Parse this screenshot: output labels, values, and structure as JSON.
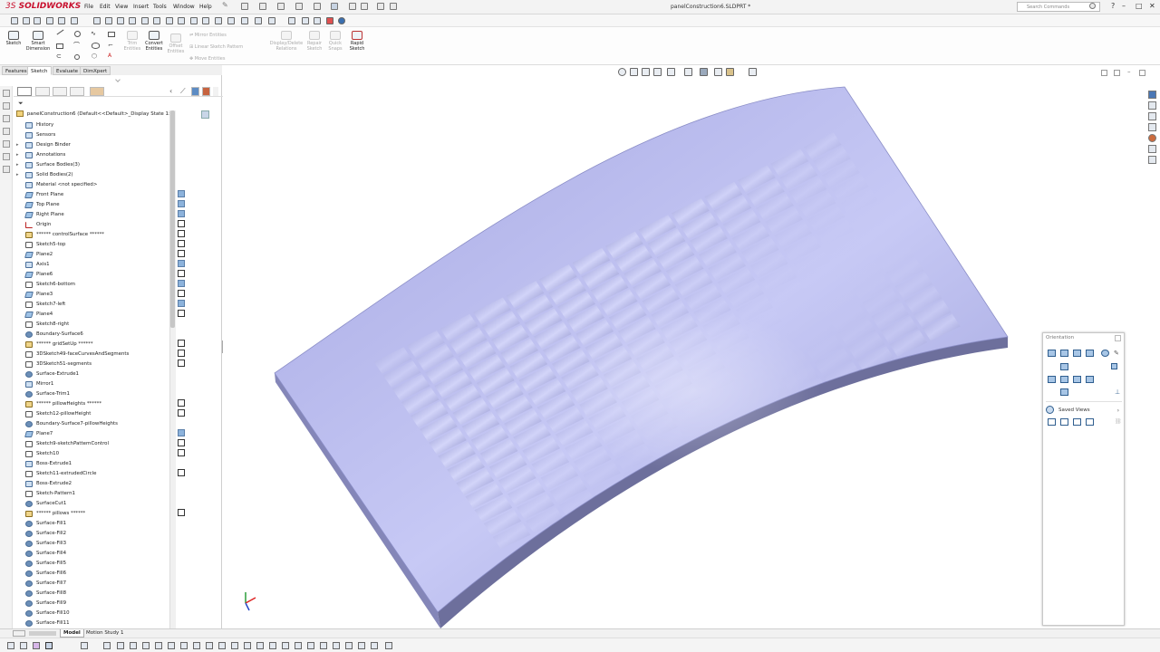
{
  "app": {
    "brand": "SOLIDWORKS",
    "brand_prefix": "3S",
    "document_title": "panelConstruction6.SLDPRT *",
    "search_placeholder": "Search Commands",
    "menus": [
      "File",
      "Edit",
      "View",
      "Insert",
      "Tools",
      "Window",
      "Help"
    ],
    "window_controls": [
      "–",
      "□",
      "✕"
    ]
  },
  "command_manager": {
    "sketch": "Sketch",
    "smart_dimension": "Smart Dimension",
    "trim_entities": "Trim Entities",
    "convert_entities": "Convert Entities",
    "offset_entities": "Offset Entities",
    "mirror_entities": "Mirror Entities",
    "linear_sketch_pattern": "Linear Sketch Pattern",
    "move_entities": "Move Entities",
    "display_delete_relations": "Display/Delete Relations",
    "repair_sketch": "Repair Sketch",
    "quick_snaps": "Quick Snaps",
    "rapid_sketch": "Rapid Sketch"
  },
  "tabs": [
    "Features",
    "Sketch",
    "Evaluate",
    "DimXpert"
  ],
  "active_tab": "Sketch",
  "feature_tree": {
    "root": "panelConstruction6  (Default<<Default>_Display State 1>)",
    "items": [
      {
        "label": "History",
        "icon": "history-icon",
        "expandable": false
      },
      {
        "label": "Sensors",
        "icon": "sensors-icon",
        "expandable": false
      },
      {
        "label": "Design Binder",
        "icon": "design-binder-icon",
        "expandable": true
      },
      {
        "label": "Annotations",
        "icon": "annotations-icon",
        "expandable": true
      },
      {
        "label": "Surface Bodies(3)",
        "icon": "surface-bodies-icon",
        "expandable": true
      },
      {
        "label": "Solid Bodies(2)",
        "icon": "solid-bodies-icon",
        "expandable": true
      },
      {
        "label": "Material <not specified>",
        "icon": "material-icon",
        "expandable": false
      },
      {
        "label": "Front Plane",
        "icon": "plane-icon",
        "expandable": false
      },
      {
        "label": "Top Plane",
        "icon": "plane-icon",
        "expandable": false
      },
      {
        "label": "Right Plane",
        "icon": "plane-icon",
        "expandable": false
      },
      {
        "label": "Origin",
        "icon": "origin-icon",
        "expandable": false
      },
      {
        "label": "****** controlSurface ******",
        "icon": "folder-icon",
        "expandable": false
      },
      {
        "label": "Sketch5-top",
        "icon": "sketch-icon",
        "expandable": false
      },
      {
        "label": "Plane2",
        "icon": "plane-icon",
        "expandable": false
      },
      {
        "label": "Axis1",
        "icon": "axis-icon",
        "expandable": false
      },
      {
        "label": "Plane6",
        "icon": "plane-icon",
        "expandable": false
      },
      {
        "label": "Sketch6-bottom",
        "icon": "sketch-icon",
        "expandable": false
      },
      {
        "label": "Plane3",
        "icon": "plane-icon",
        "expandable": false
      },
      {
        "label": "Sketch7-left",
        "icon": "sketch-icon",
        "expandable": false
      },
      {
        "label": "Plane4",
        "icon": "plane-icon",
        "expandable": false
      },
      {
        "label": "Sketch8-right",
        "icon": "sketch-icon",
        "expandable": false
      },
      {
        "label": "Boundary-Surface6",
        "icon": "surface-icon",
        "expandable": false
      },
      {
        "label": "****** gridSetUp ******",
        "icon": "folder-icon",
        "expandable": false
      },
      {
        "label": "3DSketch49-faceCurvesAndSegments",
        "icon": "3dsketch-icon",
        "expandable": false
      },
      {
        "label": "3DSketch51-segments",
        "icon": "3dsketch-icon",
        "expandable": false
      },
      {
        "label": "Surface-Extrude1",
        "icon": "surface-icon",
        "expandable": false
      },
      {
        "label": "Mirror1",
        "icon": "mirror-icon",
        "expandable": false
      },
      {
        "label": "Surface-Trim1",
        "icon": "surface-icon",
        "expandable": false
      },
      {
        "label": "****** pillowHeights ******",
        "icon": "folder-icon",
        "expandable": false
      },
      {
        "label": "Sketch12-pillowHeight",
        "icon": "sketch-icon",
        "expandable": false
      },
      {
        "label": "Boundary-Surface7-pillowHeights",
        "icon": "surface-icon",
        "expandable": false
      },
      {
        "label": "Plane7",
        "icon": "plane-icon",
        "expandable": false
      },
      {
        "label": "Sketch9-sketchPatternControl",
        "icon": "sketch-icon",
        "expandable": false
      },
      {
        "label": "Sketch10",
        "icon": "sketch-icon",
        "expandable": false
      },
      {
        "label": "Boss-Extrude1",
        "icon": "extrude-icon",
        "expandable": false
      },
      {
        "label": "Sketch11-extrudedCircle",
        "icon": "sketch-icon",
        "expandable": false
      },
      {
        "label": "Boss-Extrude2",
        "icon": "extrude-icon",
        "expandable": false
      },
      {
        "label": "Sketch-Pattern1",
        "icon": "sketch-icon",
        "expandable": false
      },
      {
        "label": "SurfaceCut1",
        "icon": "surface-icon",
        "expandable": false
      },
      {
        "label": "****** pillows ******",
        "icon": "folder-icon",
        "expandable": false
      },
      {
        "label": "Surface-Fill1",
        "icon": "surface-icon",
        "expandable": false
      },
      {
        "label": "Surface-Fill2",
        "icon": "surface-icon",
        "expandable": false
      },
      {
        "label": "Surface-Fill3",
        "icon": "surface-icon",
        "expandable": false
      },
      {
        "label": "Surface-Fill4",
        "icon": "surface-icon",
        "expandable": false
      },
      {
        "label": "Surface-Fill5",
        "icon": "surface-icon",
        "expandable": false
      },
      {
        "label": "Surface-Fill6",
        "icon": "surface-icon",
        "expandable": false
      },
      {
        "label": "Surface-Fill7",
        "icon": "surface-icon",
        "expandable": false
      },
      {
        "label": "Surface-Fill8",
        "icon": "surface-icon",
        "expandable": false
      },
      {
        "label": "Surface-Fill9",
        "icon": "surface-icon",
        "expandable": false
      },
      {
        "label": "Surface-Fill10",
        "icon": "surface-icon",
        "expandable": false
      },
      {
        "label": "Surface-Fill11",
        "icon": "surface-icon",
        "expandable": false
      }
    ]
  },
  "bottom_tabs": [
    "Model",
    "Motion Study 1"
  ],
  "active_bottom_tab": "Model",
  "orientation_dialog": {
    "title": "Orientation",
    "saved_views": "Saved Views",
    "saved_views_arrow": "›"
  },
  "colors": {
    "brand_red": "#c8102e",
    "model_face": "#a9ace8",
    "model_edge": "#6a6c9a"
  }
}
